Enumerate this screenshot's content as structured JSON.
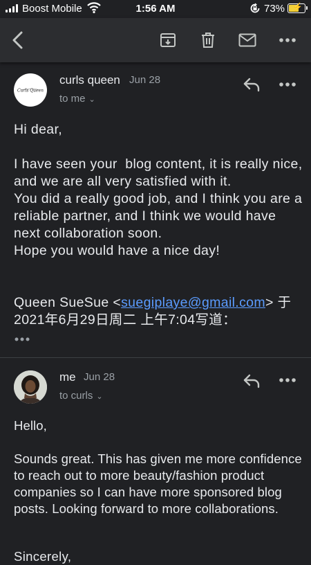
{
  "status_bar": {
    "carrier": "Boost Mobile",
    "time": "1:56 AM",
    "battery_percent_text": "73%",
    "battery_level": 0.73,
    "battery_color": "#f2d13a",
    "icons": [
      "signal-icon",
      "wifi-icon",
      "rotation-lock-icon",
      "battery-charging-icon"
    ]
  },
  "toolbar": {
    "icons": [
      "back-arrow-icon",
      "archive-icon",
      "trash-icon",
      "mail-icon",
      "more-vert-icon"
    ]
  },
  "messages": [
    {
      "sender": "curls queen",
      "date": "Jun 28",
      "recipient": "to me",
      "avatar_logo_text": "Curls Queen",
      "body": "Hi dear,\n\nI have seen your  blog content, it is really nice, and we are all very satisfied with it.\nYou did a really good job, and I think you are a reliable partner, and I think we would have next collaboration soon.\nHope you would have a nice day!",
      "quote_prefix": "Queen SueSue <",
      "quote_email": "suegiplaye@gmail.com",
      "quote_suffix": "> 于",
      "quote_line2": "2021年6月29日周二 上午7:04写道："
    },
    {
      "sender": "me",
      "date": "Jun 28",
      "recipient": "to curls",
      "body": "Hello,\n\nSounds great. This has given me more confidence to reach out to more beauty/fashion product companies so I can have more sponsored blog posts. Looking forward to more collaborations.",
      "signoff": "Sincerely,"
    }
  ],
  "colors": {
    "background": "#202124",
    "toolbar": "#2c2d30",
    "link": "#5b9cff",
    "secondary_text": "#9aa0a6"
  }
}
